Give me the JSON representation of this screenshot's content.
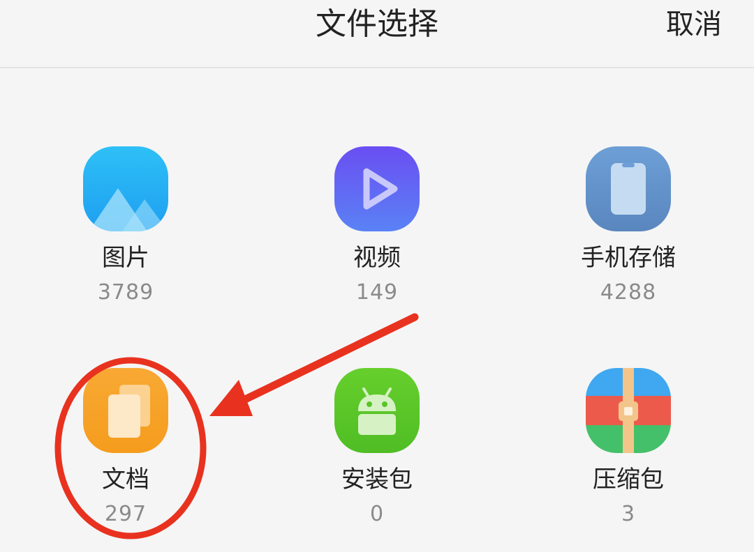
{
  "header": {
    "title": "文件选择",
    "cancel_label": "取消"
  },
  "categories": [
    {
      "label": "图片",
      "count": "3789",
      "icon": "images-icon",
      "color": "#29b6f6"
    },
    {
      "label": "视频",
      "count": "149",
      "icon": "video-play-icon",
      "color": "#6a5cf0"
    },
    {
      "label": "手机存储",
      "count": "4288",
      "icon": "phone-storage-icon",
      "color": "#5b8fc7"
    },
    {
      "label": "文档",
      "count": "297",
      "icon": "documents-icon",
      "color": "#f6a623"
    },
    {
      "label": "安装包",
      "count": "0",
      "icon": "android-apk-icon",
      "color": "#5cc82b"
    },
    {
      "label": "压缩包",
      "count": "3",
      "icon": "zip-archive-icon",
      "color": "#ec5a4b"
    }
  ],
  "annotation": {
    "highlight_color": "#e8321f",
    "highlighted_item": "文档"
  }
}
